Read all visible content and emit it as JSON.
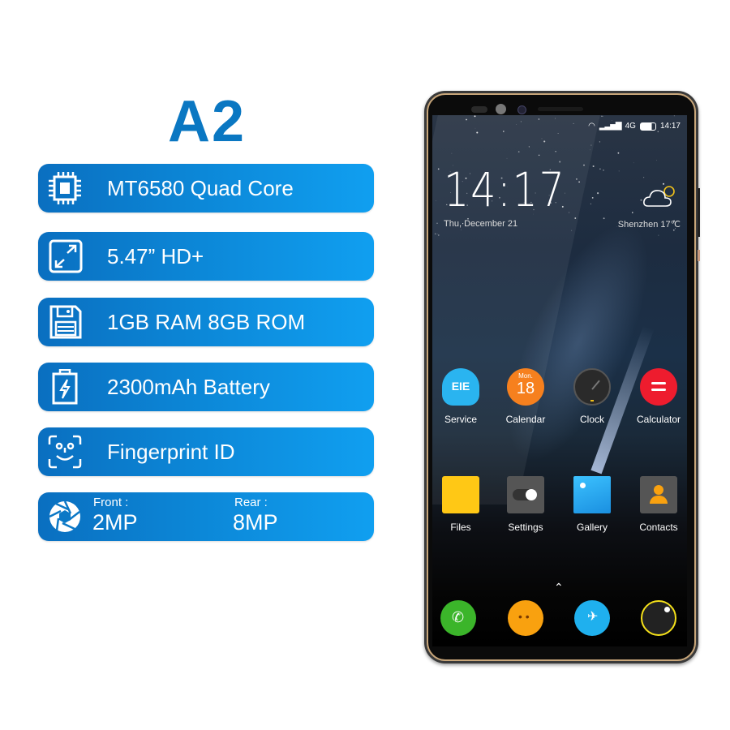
{
  "product": {
    "title": "A2"
  },
  "specs": [
    {
      "icon": "cpu-icon",
      "label": "MT6580 Quad Core"
    },
    {
      "icon": "expand-icon",
      "label": "5.47” HD+"
    },
    {
      "icon": "floppy-disk-icon",
      "label": "1GB RAM 8GB ROM"
    },
    {
      "icon": "battery-icon",
      "label": "2300mAh Battery"
    },
    {
      "icon": "face-id-icon",
      "label": "Fingerprint ID"
    }
  ],
  "camera": {
    "icon": "aperture-icon",
    "front_label": "Front :",
    "front_value": "2MP",
    "rear_label": "Rear :",
    "rear_value": "8MP"
  },
  "phone": {
    "status": {
      "network": "4G",
      "time": "14:17"
    },
    "lock_clock": "14:17",
    "date": "Thu,  December 21",
    "weather": "Shenzhen 17℃",
    "calendar_icon": {
      "day": "Mon.",
      "date": "18"
    },
    "apps_row1": [
      {
        "label": "Service",
        "color": "#2ab4f0"
      },
      {
        "label": "Calendar",
        "color": "#f6801e"
      },
      {
        "label": "Clock",
        "color": "#2a2a2a"
      },
      {
        "label": "Calculator",
        "color": "#ee1c2e"
      }
    ],
    "apps_row2": [
      {
        "label": "Files",
        "color": "#ffc815"
      },
      {
        "label": "Settings",
        "color": "#555555"
      },
      {
        "label": "Gallery",
        "color": "#1aa0ee"
      },
      {
        "label": "Contacts",
        "color": "#555555"
      }
    ],
    "dock": [
      {
        "name": "phone",
        "color": "#3bb52a"
      },
      {
        "name": "messages",
        "color": "#f9a10f"
      },
      {
        "name": "browser",
        "color": "#1fb0ee"
      },
      {
        "name": "camera",
        "color": "#222222"
      }
    ]
  },
  "colors": {
    "brand_blue": "#0a77c2"
  }
}
